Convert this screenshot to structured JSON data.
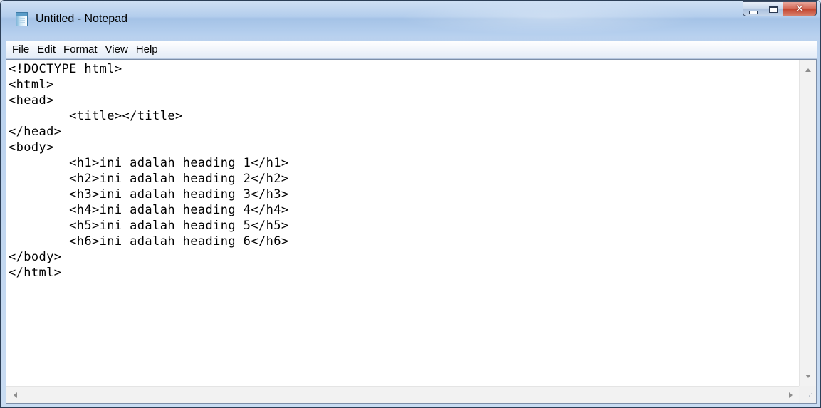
{
  "window": {
    "title": "Untitled - Notepad",
    "icon": "notepad-icon",
    "controls": {
      "minimize": "minimize-icon",
      "maximize": "maximize-icon",
      "close": "close-icon"
    }
  },
  "menu": [
    "File",
    "Edit",
    "Format",
    "View",
    "Help"
  ],
  "editor": {
    "lines": [
      "<!DOCTYPE html>",
      "<html>",
      "<head>",
      "        <title></title>",
      "</head>",
      "<body>",
      "        <h1>ini adalah heading 1</h1>",
      "        <h2>ini adalah heading 2</h2>",
      "        <h3>ini adalah heading 3</h3>",
      "        <h4>ini adalah heading 4</h4>",
      "        <h5>ini adalah heading 5</h5>",
      "        <h6>ini adalah heading 6</h6>",
      "</body>",
      "</html>"
    ]
  },
  "colors": {
    "frame": "#b9d1ee",
    "close_button": "#c2422c",
    "editor_background": "#ffffff"
  }
}
